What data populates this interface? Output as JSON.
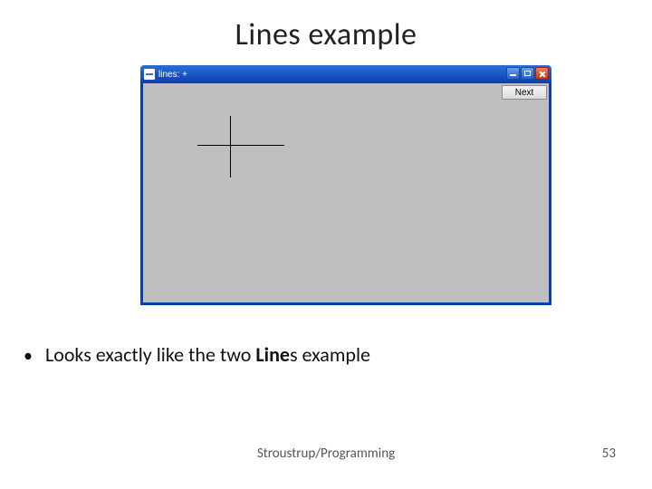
{
  "slide": {
    "title": "Lines example",
    "footer": "Stroustrup/Programming",
    "page_number": "53"
  },
  "window": {
    "title": "lines: +",
    "next_button_label": "Next"
  },
  "bullet": {
    "prefix": "Looks exactly like the two ",
    "bold": "Line",
    "suffix": "s example"
  }
}
